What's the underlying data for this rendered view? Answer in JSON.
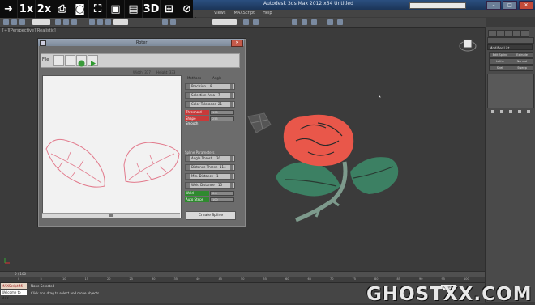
{
  "overlay_toolbar": [
    "1x",
    "2x",
    "3D"
  ],
  "app": {
    "title": "Autodesk 3ds Max 2012 x64      Untitled",
    "menus": [
      "Views",
      "MAXScript",
      "Help"
    ]
  },
  "viewport": {
    "label": "[+][Perspective][Realistic]"
  },
  "command_panel": {
    "modifier_list": "Modifier List",
    "buttons": [
      "Edit Spline",
      "Extrude",
      "Lathe",
      "Normal",
      "Shell",
      "Sweep"
    ]
  },
  "dialog": {
    "title": "Roter",
    "file_menu": "File",
    "close_label": "✕",
    "canvas_width_label": "Width: 337",
    "canvas_height_label": "Height: 333",
    "tabs": [
      "Methods",
      "Angle"
    ],
    "params_top": [
      {
        "label": "Precision",
        "value": "8"
      },
      {
        "label": "Selection Area",
        "value": "7"
      },
      {
        "label": "Color Tolerance",
        "value": "21"
      }
    ],
    "red_labels": [
      "Threshold",
      "Shape Smooth"
    ],
    "red_values": [
      "190",
      "255"
    ],
    "section_header": "Spline Parameters",
    "params_bottom": [
      {
        "label": "Angle Thresh",
        "value": "30"
      },
      {
        "label": "Distance Thresh",
        "value": "114"
      },
      {
        "label": "Min. Distance",
        "value": "1"
      },
      {
        "label": "Weld Distance",
        "value": "15"
      }
    ],
    "green_labels": [
      "Weld",
      "Auto Steps"
    ],
    "green_values": [
      "0.8",
      "100"
    ],
    "create_button": "Create Spline"
  },
  "timeline": {
    "counter": "0 / 100",
    "ticks": [
      "0",
      "5",
      "10",
      "15",
      "20",
      "25",
      "30",
      "35",
      "40",
      "45",
      "50",
      "55",
      "60",
      "65",
      "70",
      "75",
      "80",
      "85",
      "90",
      "95",
      "100"
    ]
  },
  "status": {
    "listener": "MAXScript Mi",
    "command": "Welcome to MAX",
    "selection": "None Selected",
    "prompt": "Click and drag to select and move objects",
    "selected_dropdown": "Selected"
  },
  "watermark": "GHOSTXX.COM",
  "colors": {
    "rose_petal": "#e9574a",
    "leaf": "#3c8063",
    "stem": "#7d9a8c",
    "sketch": "#e27a8c"
  }
}
